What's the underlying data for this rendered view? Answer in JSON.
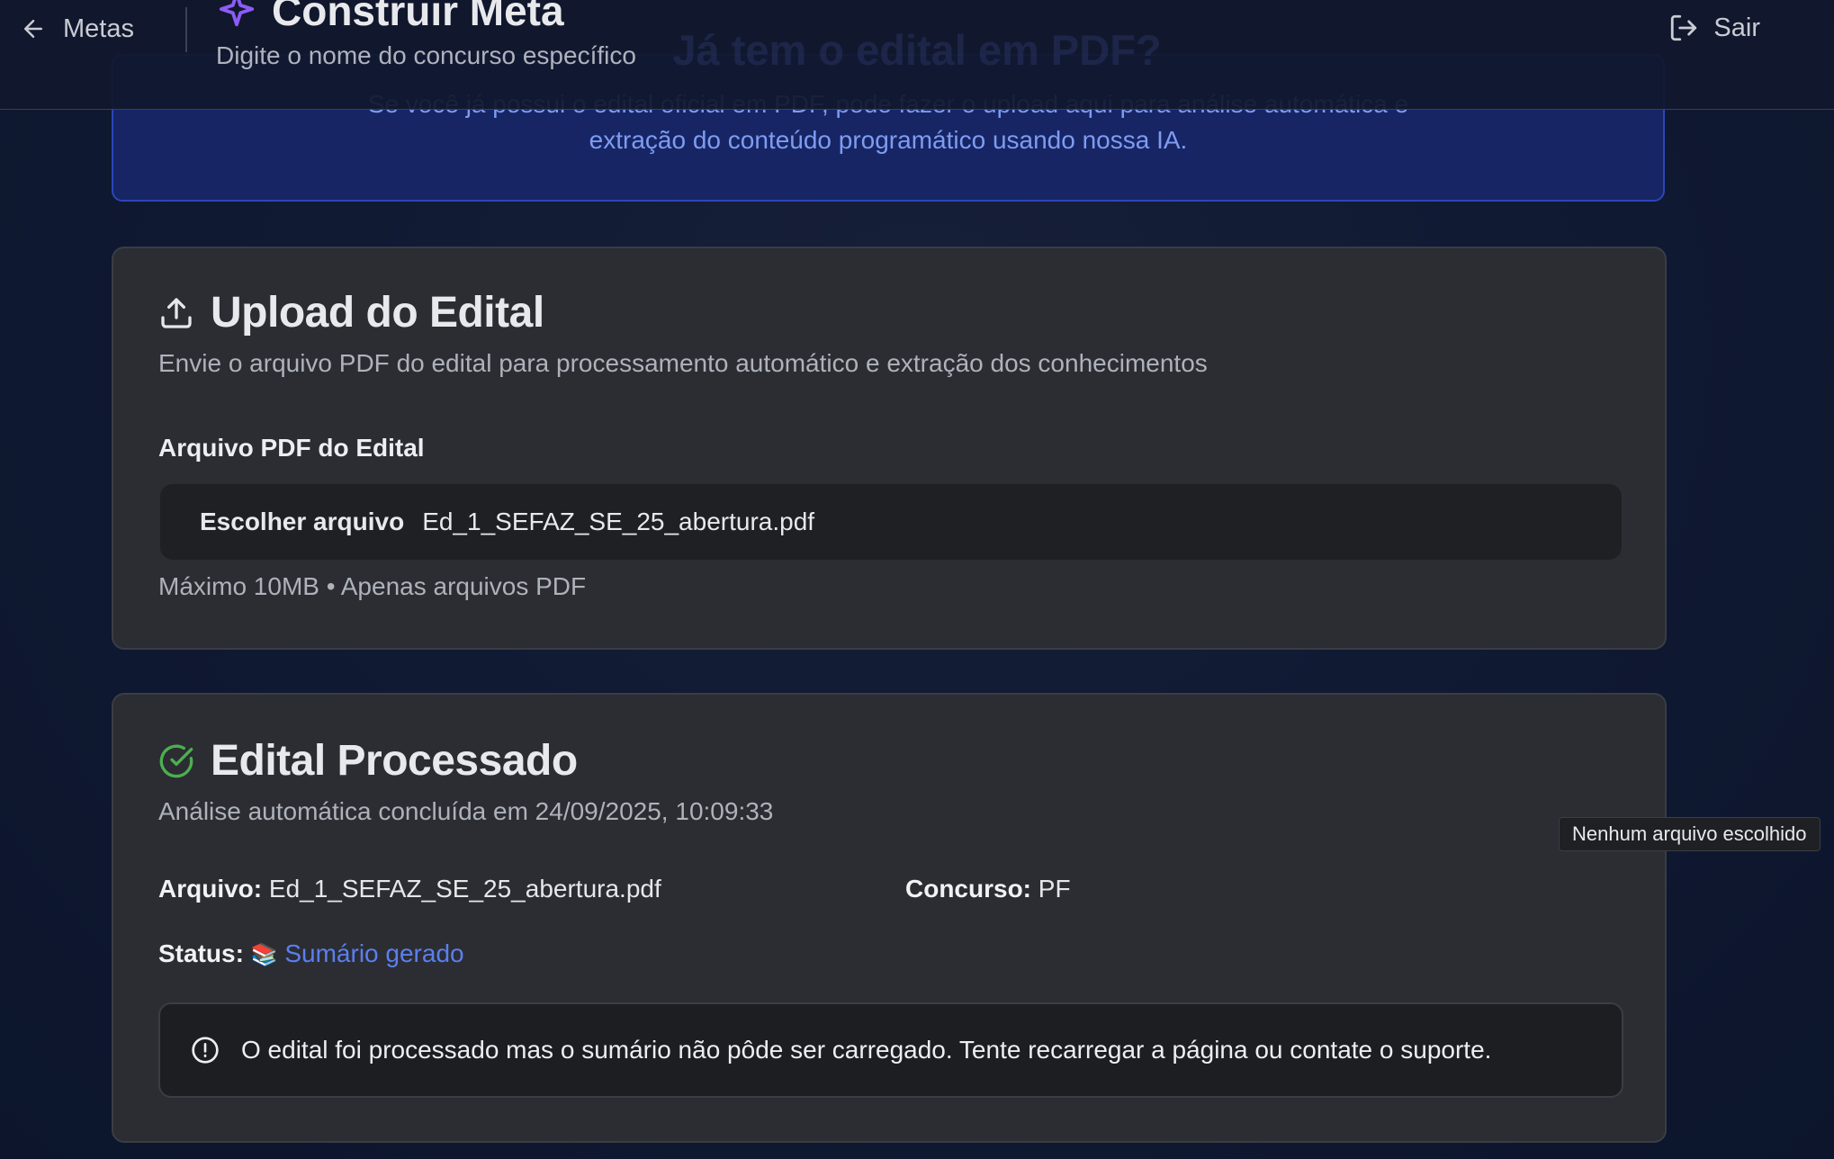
{
  "header": {
    "back_label": "Metas",
    "title": "Construir Meta",
    "subtitle": "Digite o nome do concurso específico",
    "logout_label": "Sair",
    "behind_title": "Já tem o edital em PDF?"
  },
  "info_banner": {
    "line1": "Se você já possui o edital oficial em PDF, pode fazer o upload aqui para análise automática e",
    "line2": "extração do conteúdo programático usando nossa IA."
  },
  "upload_card": {
    "title": "Upload do Edital",
    "description": "Envie o arquivo PDF do edital para processamento automático e extração dos conhecimentos",
    "field_label": "Arquivo PDF do Edital",
    "choose_button": "Escolher arquivo",
    "file_name": "Ed_1_SEFAZ_SE_25_abertura.pdf",
    "hint": "Máximo 10MB • Apenas arquivos PDF"
  },
  "processed_card": {
    "title": "Edital Processado",
    "description": "Análise automática concluída em 24/09/2025, 10:09:33",
    "file_label": "Arquivo:",
    "file_value": "Ed_1_SEFAZ_SE_25_abertura.pdf",
    "contest_label": "Concurso:",
    "contest_value": "PF",
    "status_label": "Status:",
    "status_emoji": "📚",
    "status_value": "Sumário gerado",
    "alert_text": "O edital foi processado mas o sumário não pôde ser carregado. Tente recarregar a página ou contate o suporte."
  },
  "tooltip": "Nenhum arquivo escolhido",
  "colors": {
    "accent_purple": "#8b5cf6",
    "success_green": "#4caf50",
    "link_blue": "#5b7ff0",
    "banner_bg": "#172565"
  }
}
